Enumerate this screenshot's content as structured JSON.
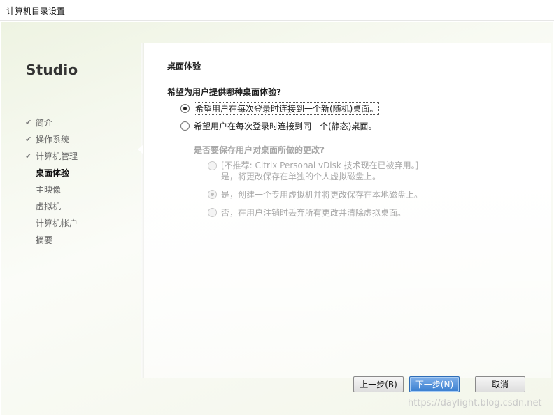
{
  "window": {
    "title": "计算机目录设置"
  },
  "sidebar": {
    "brand": "Studio",
    "steps": [
      {
        "label": "简介",
        "state": "done"
      },
      {
        "label": "操作系统",
        "state": "done"
      },
      {
        "label": "计算机管理",
        "state": "done"
      },
      {
        "label": "桌面体验",
        "state": "current"
      },
      {
        "label": "主映像",
        "state": "pending"
      },
      {
        "label": "虚拟机",
        "state": "pending"
      },
      {
        "label": "计算机帐户",
        "state": "pending"
      },
      {
        "label": "摘要",
        "state": "pending"
      }
    ]
  },
  "main": {
    "section_title": "桌面体验",
    "question": "希望为用户提供哪种桌面体验?",
    "options": [
      {
        "label": "希望用户在每次登录时连接到一个新(随机)桌面。",
        "checked": true
      },
      {
        "label": "希望用户在每次登录时连接到同一个(静态)桌面。",
        "checked": false
      }
    ],
    "sub_question": "是否要保存用户对桌面所做的更改?",
    "sub_options": [
      {
        "line1": "[不推荐: Citrix Personal vDisk 技术现在已被弃用。]",
        "line2": "是，将更改保存在单独的个人虚拟磁盘上。",
        "checked": false,
        "enabled": false
      },
      {
        "label": "是，创建一个专用虚拟机并将更改保存在本地磁盘上。",
        "checked": true,
        "enabled": false
      },
      {
        "label": "否，在用户注销时丢弃所有更改并清除虚拟桌面。",
        "checked": false,
        "enabled": false
      }
    ]
  },
  "footer": {
    "back_label": "上一步(B)",
    "next_label": "下一步(N)",
    "cancel_label": "取消"
  },
  "watermark": "https://daylight.blog.csdn.net",
  "colors": {
    "primary_button": "#3a7fd0",
    "disabled_text": "#a8a8a8"
  }
}
